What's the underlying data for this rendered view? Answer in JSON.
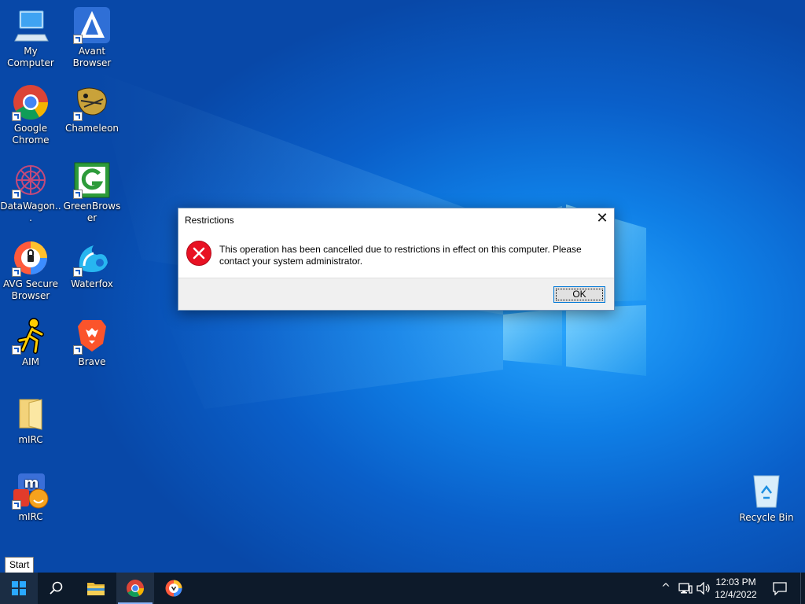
{
  "desktop": {
    "icons": [
      {
        "label": "My Computer"
      },
      {
        "label": "Avant Browser"
      },
      {
        "label": "Google Chrome"
      },
      {
        "label": "Chameleon"
      },
      {
        "label": "DataWagon..."
      },
      {
        "label": "GreenBrowser"
      },
      {
        "label": "AVG Secure Browser"
      },
      {
        "label": "Waterfox"
      },
      {
        "label": "AIM"
      },
      {
        "label": "Brave"
      },
      {
        "label": "mIRC"
      },
      {
        "label": "mIRC"
      },
      {
        "label": "Recycle Bin"
      }
    ]
  },
  "dialog": {
    "title": "Restrictions",
    "close_glyph": "✕",
    "message": "This operation has been cancelled due to restrictions in effect on this computer. Please contact your system administrator.",
    "ok_label": "OK"
  },
  "tooltip": {
    "text": "Start"
  },
  "taskbar": {
    "pinned": [
      "start-button",
      "search-button",
      "file-explorer",
      "google-chrome",
      "avg-secure-browser"
    ],
    "tray": {
      "chevron": "^",
      "time": "12:03 PM",
      "date": "12/4/2022"
    }
  },
  "colors": {
    "desktop_blue": "#0a5fc9",
    "taskbar": "#0d1a2a",
    "error_red": "#e81123",
    "focus_blue": "#0078d7"
  }
}
